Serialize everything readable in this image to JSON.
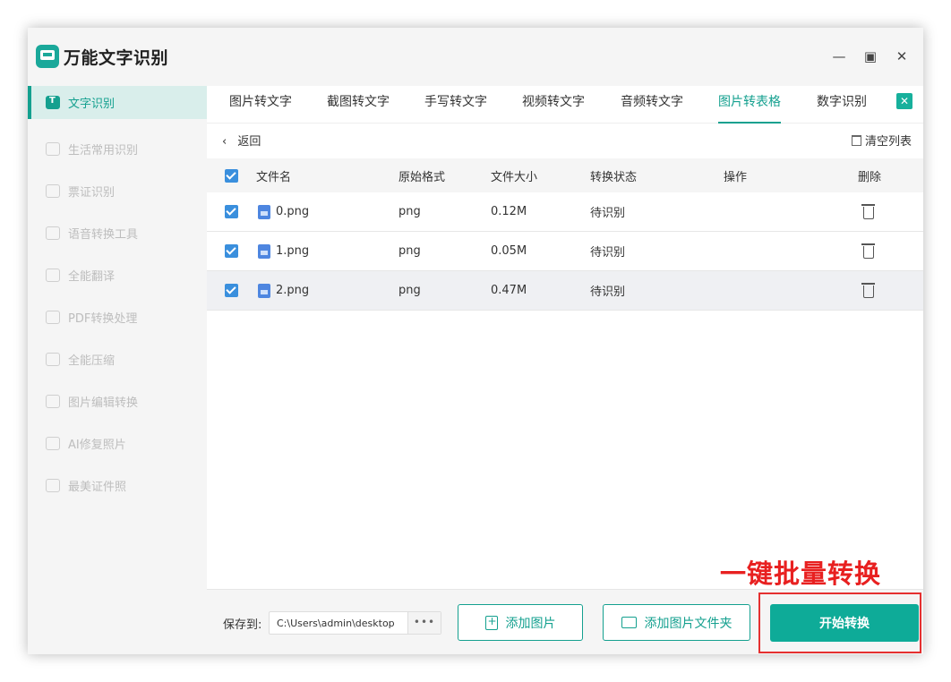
{
  "app": {
    "name": "万能文字识别"
  },
  "window_controls": {
    "minimize": "—",
    "maximize": "▣",
    "close": "✕"
  },
  "sidebar": {
    "items": [
      {
        "label": "文字识别",
        "active": true
      },
      {
        "label": "生活常用识别",
        "active": false
      },
      {
        "label": "票证识别",
        "active": false
      },
      {
        "label": "语音转换工具",
        "active": false
      },
      {
        "label": "全能翻译",
        "active": false
      },
      {
        "label": "PDF转换处理",
        "active": false
      },
      {
        "label": "全能压缩",
        "active": false
      },
      {
        "label": "图片编辑转换",
        "active": false
      },
      {
        "label": "AI修复照片",
        "active": false
      },
      {
        "label": "最美证件照",
        "active": false
      }
    ]
  },
  "tabs": [
    {
      "label": "图片转文字",
      "active": false
    },
    {
      "label": "截图转文字",
      "active": false
    },
    {
      "label": "手写转文字",
      "active": false
    },
    {
      "label": "视频转文字",
      "active": false
    },
    {
      "label": "音频转文字",
      "active": false
    },
    {
      "label": "图片转表格",
      "active": true
    },
    {
      "label": "数字识别",
      "active": false
    }
  ],
  "tab_close": "✕",
  "list": {
    "back_label": "返回",
    "back_icon": "‹",
    "clear_label": "清空列表",
    "columns": [
      "文件名",
      "原始格式",
      "文件大小",
      "转换状态",
      "操作",
      "删除"
    ],
    "rows": [
      {
        "name": "0.png",
        "format": "png",
        "size": "0.12M",
        "status": "待识别"
      },
      {
        "name": "1.png",
        "format": "png",
        "size": "0.05M",
        "status": "待识别"
      },
      {
        "name": "2.png",
        "format": "png",
        "size": "0.47M",
        "status": "待识别"
      }
    ]
  },
  "footer": {
    "save_label": "保存到:",
    "path": "C:\\Users\\admin\\desktop",
    "more": "•••",
    "add_image": "添加图片",
    "add_folder": "添加图片文件夹",
    "start": "开始转换"
  },
  "annotation": {
    "text": "一键批量转换",
    "color": "#e82020"
  },
  "colors": {
    "accent": "#14a08f",
    "checkbox": "#3a8fdd",
    "primary_button": "#0eab98"
  }
}
